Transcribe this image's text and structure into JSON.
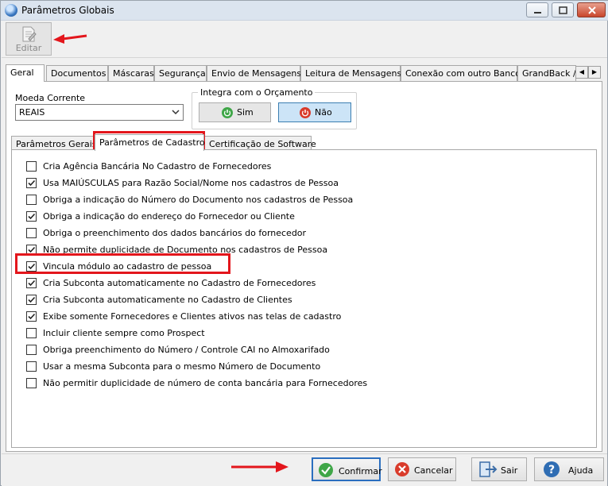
{
  "window": {
    "title": "Parâmetros Globais"
  },
  "toolbar": {
    "edit_label": "Editar"
  },
  "tabs": [
    "Geral",
    "Documentos",
    "Máscaras",
    "Segurança",
    "Envio de Mensagens",
    "Leitura de Mensagens",
    "Conexão com outro Banco",
    "GrandBack / I"
  ],
  "currency": {
    "label": "Moeda Corrente",
    "value": "REAIS"
  },
  "budget_group": {
    "title": "Integra com o Orçamento",
    "yes_label": "Sim",
    "no_label": "Não"
  },
  "subtabs": [
    "Parâmetros Gerais",
    "Parâmetros de Cadastro",
    "Certificação de Software"
  ],
  "options": [
    {
      "label": "Cria Agência Bancária No Cadastro de Fornecedores",
      "checked": false
    },
    {
      "label": "Usa MAIÚSCULAS para Razão Social/Nome nos cadastros de Pessoa",
      "checked": true
    },
    {
      "label": "Obriga a indicação do Número do Documento nos cadastros de Pessoa",
      "checked": false
    },
    {
      "label": "Obriga a indicação do endereço do Fornecedor ou Cliente",
      "checked": true
    },
    {
      "label": "Obriga o preenchimento dos dados bancários do fornecedor",
      "checked": false
    },
    {
      "label": "Não permite duplicidade de Documento nos cadastros de Pessoa",
      "checked": true
    },
    {
      "label": "Vincula módulo ao cadastro de pessoa",
      "checked": true
    },
    {
      "label": "Cria Subconta automaticamente no Cadastro de Fornecedores",
      "checked": true
    },
    {
      "label": "Cria Subconta automaticamente no Cadastro de Clientes",
      "checked": true
    },
    {
      "label": "Exibe somente Fornecedores e Clientes ativos nas telas de cadastro",
      "checked": true
    },
    {
      "label": "Incluir cliente sempre como Prospect",
      "checked": false
    },
    {
      "label": "Obriga preenchimento do Número / Controle CAI no Almoxarifado",
      "checked": false
    },
    {
      "label": "Usar a mesma Subconta para o mesmo Número de Documento",
      "checked": false
    },
    {
      "label": "Não permitir duplicidade de número de conta bancária para Fornecedores",
      "checked": false
    }
  ],
  "footer": {
    "confirm_label": "Confirmar",
    "cancel_label": "Cancelar",
    "exit_label": "Sair",
    "help_label": "Ajuda"
  },
  "colors": {
    "highlight": "#e3161c",
    "accent": "#2a6ebf"
  }
}
